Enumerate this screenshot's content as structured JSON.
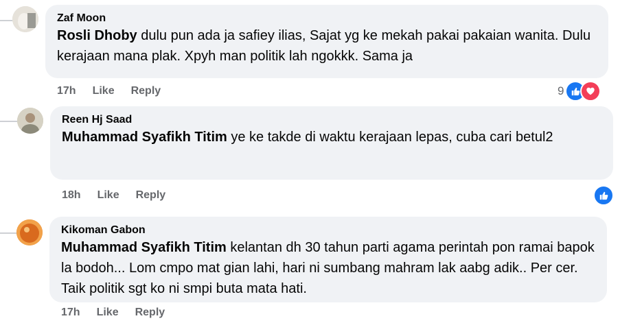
{
  "comments": [
    {
      "author": "Zaf Moon",
      "mention": "Rosli Dhoby",
      "text": " dulu pun ada ja safiey ilias, Sajat yg ke mekah pakai pakaian wanita. Dulu kerajaan mana plak. Xpyh man politik lah ngokkk. Sama ja",
      "time": "17h",
      "like_label": "Like",
      "reply_label": "Reply",
      "reaction_count": "9",
      "reactions": [
        "like-icon",
        "love-icon"
      ]
    },
    {
      "author": "Reen Hj Saad",
      "mention": "Muhammad Syafikh Titim",
      "text": " ye ke takde di waktu kerajaan lepas, cuba cari betul2",
      "time": "18h",
      "like_label": "Like",
      "reply_label": "Reply",
      "reactions": [
        "like-icon"
      ]
    },
    {
      "author": "Kikoman Gabon",
      "mention": "Muhammad Syafikh Titim",
      "text": " kelantan dh 30 tahun parti agama perintah pon ramai bapok la bodoh... Lom cmpo mat gian lahi, hari ni sumbang mahram lak aabg adik.. Per cer. Taik politik sgt ko ni smpi buta mata hati.",
      "time": "17h",
      "like_label": "Like",
      "reply_label": "Reply"
    }
  ],
  "colors": {
    "like": "#1877f2",
    "love": "#f33e58",
    "bubble": "#f0f2f5",
    "meta": "#65676b"
  }
}
